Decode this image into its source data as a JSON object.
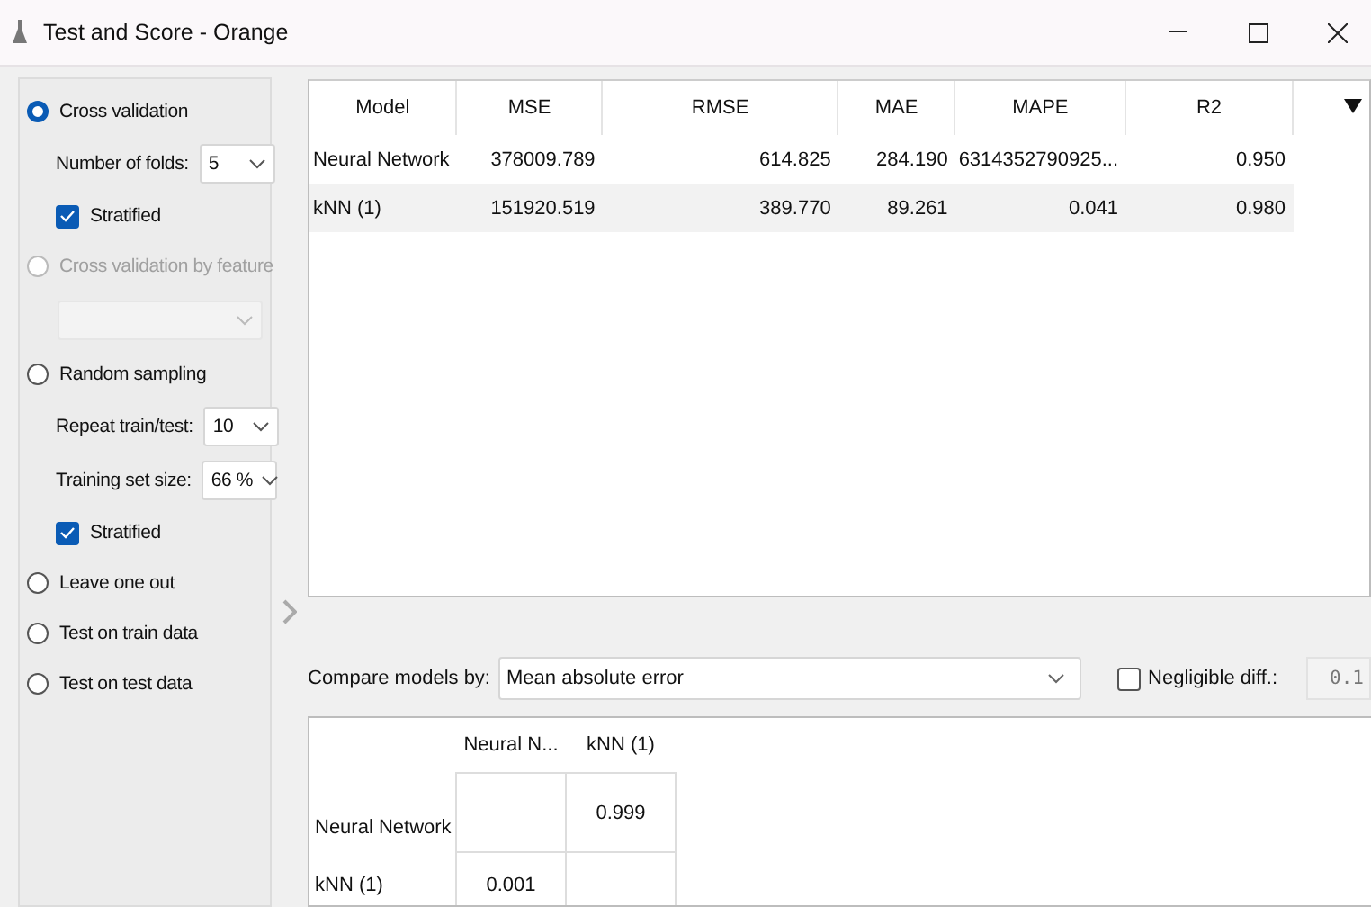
{
  "window": {
    "title": "Test and Score - Orange"
  },
  "sampling": [
    {
      "kind": "radio",
      "label": "Cross validation",
      "selected": true,
      "disabled": false
    },
    {
      "kind": "dropdown",
      "label": "Number of folds:",
      "value": "5"
    },
    {
      "kind": "checkbox",
      "label": "Stratified",
      "checked": true
    },
    {
      "kind": "radio",
      "label": "Cross validation by feature",
      "selected": false,
      "disabled": true
    },
    {
      "kind": "dropdown",
      "disabled": true
    },
    {
      "kind": "radio",
      "label": "Random sampling",
      "selected": false,
      "disabled": false
    },
    {
      "kind": "dropdown",
      "label": "Repeat train/test:",
      "value": "10"
    },
    {
      "kind": "dropdown",
      "label": "Training set size:",
      "value": "66 %"
    },
    {
      "kind": "checkbox",
      "label": "Stratified",
      "checked": true
    },
    {
      "kind": "radio",
      "label": "Leave one out",
      "selected": false,
      "disabled": false
    },
    {
      "kind": "radio",
      "label": "Test on train data",
      "selected": false,
      "disabled": false
    },
    {
      "kind": "radio",
      "label": "Test on test data",
      "selected": false,
      "disabled": false
    }
  ],
  "results": {
    "columns": [
      "Model",
      "MSE",
      "RMSE",
      "MAE",
      "MAPE",
      "R2"
    ],
    "rows": [
      [
        "Neural Network",
        "378009.789",
        "614.825",
        "284.190",
        "6314352790925...",
        "0.950"
      ],
      [
        "kNN (1)",
        "151920.519",
        "389.770",
        "89.261",
        "0.041",
        "0.980"
      ]
    ]
  },
  "compare": {
    "label": "Compare models by:",
    "value": "Mean absolute error",
    "negligible": {
      "label": "Negligible diff.:",
      "checked": false,
      "value": "0.1"
    }
  },
  "comparison": {
    "columns": [
      "Neural N...",
      "kNN (1)"
    ],
    "rows": [
      {
        "name": "Neural Network",
        "cells": [
          null,
          "0.999"
        ]
      },
      {
        "name": "kNN (1)",
        "cells": [
          "0.001",
          null
        ]
      }
    ]
  }
}
